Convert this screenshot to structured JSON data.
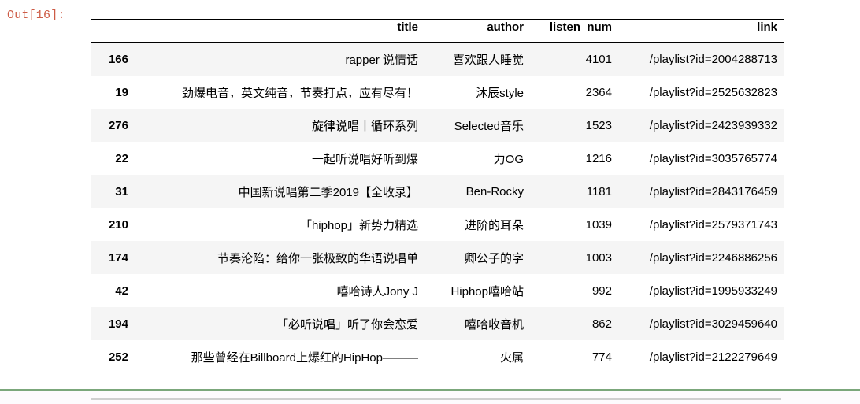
{
  "notebook": {
    "output_prompt": "Out[16]:",
    "prompt_color": "#cd5b45",
    "cell_separator_color": "#7ba77b"
  },
  "table": {
    "index_header": "",
    "columns": [
      "title",
      "author",
      "listen_num",
      "link"
    ],
    "rows": [
      {
        "index": "166",
        "title": "rapper 说情话",
        "author": "喜欢跟人睡觉",
        "listen_num": "4101",
        "link": "/playlist?id=2004288713"
      },
      {
        "index": "19",
        "title": "劲爆电音，英文纯音，节奏打点，应有尽有！",
        "author": "沐辰style",
        "listen_num": "2364",
        "link": "/playlist?id=2525632823"
      },
      {
        "index": "276",
        "title": "旋律说唱丨循环系列",
        "author": "Selected音乐",
        "listen_num": "1523",
        "link": "/playlist?id=2423939332"
      },
      {
        "index": "22",
        "title": "一起听说唱好听到爆",
        "author": "力OG",
        "listen_num": "1216",
        "link": "/playlist?id=3035765774"
      },
      {
        "index": "31",
        "title": "中国新说唱第二季2019【全收录】",
        "author": "Ben-Rocky",
        "listen_num": "1181",
        "link": "/playlist?id=2843176459"
      },
      {
        "index": "210",
        "title": "「hiphop」新势力精选",
        "author": "进阶的耳朵",
        "listen_num": "1039",
        "link": "/playlist?id=2579371743"
      },
      {
        "index": "174",
        "title": "节奏沦陷：给你一张极致的华语说唱单",
        "author": "卿公子的字",
        "listen_num": "1003",
        "link": "/playlist?id=2246886256"
      },
      {
        "index": "42",
        "title": "嘻哈诗人Jony J",
        "author": "Hiphop嘻哈站",
        "listen_num": "992",
        "link": "/playlist?id=1995933249"
      },
      {
        "index": "194",
        "title": "「必听说唱」听了你会恋爱",
        "author": "嘻哈收音机",
        "listen_num": "862",
        "link": "/playlist?id=3029459640"
      },
      {
        "index": "252",
        "title": "那些曾经在Billboard上爆红的HipHop———",
        "author": "火属",
        "listen_num": "774",
        "link": "/playlist?id=2122279649"
      }
    ]
  }
}
